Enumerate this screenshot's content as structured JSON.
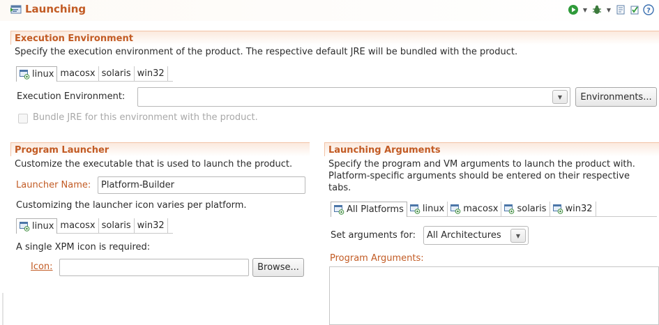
{
  "header": {
    "title": "Launching",
    "icons": [
      "launching-page-icon",
      "run-icon",
      "debug-icon",
      "export-icon",
      "validate-icon",
      "help-icon"
    ]
  },
  "execution": {
    "title": "Execution Environment",
    "description": "Specify the execution environment of the product. The respective default JRE will be bundled with the product.",
    "tabs": [
      "linux",
      "macosx",
      "solaris",
      "win32"
    ],
    "env_label": "Execution Environment:",
    "env_value": "",
    "environments_button": "Environments...",
    "bundle_label": "Bundle JRE for this environment with the product."
  },
  "launcher": {
    "title": "Program Launcher",
    "description": "Customize the executable that is used to launch the product.",
    "name_label": "Launcher Name:",
    "name_value": "Platform-Builder",
    "icon_note": "Customizing the launcher icon varies per platform.",
    "tabs": [
      "linux",
      "macosx",
      "solaris",
      "win32"
    ],
    "xpm_note": "A single XPM icon is required:",
    "icon_label": "Icon:",
    "icon_value": "",
    "browse_button": "Browse..."
  },
  "arguments": {
    "title": "Launching Arguments",
    "description_line1": "Specify the program and VM arguments to launch the product with.",
    "description_line2": "Platform-specific arguments should be entered on their respective",
    "description_line3": "tabs.",
    "tabs": [
      "All Platforms",
      "linux",
      "macosx",
      "solaris",
      "win32"
    ],
    "set_args_label": "Set arguments for:",
    "set_args_value": "All Architectures",
    "program_args_label": "Program Arguments:",
    "program_args_value": ""
  },
  "colors": {
    "accent": "#c25b24",
    "section_border": "#f2c3a6"
  }
}
